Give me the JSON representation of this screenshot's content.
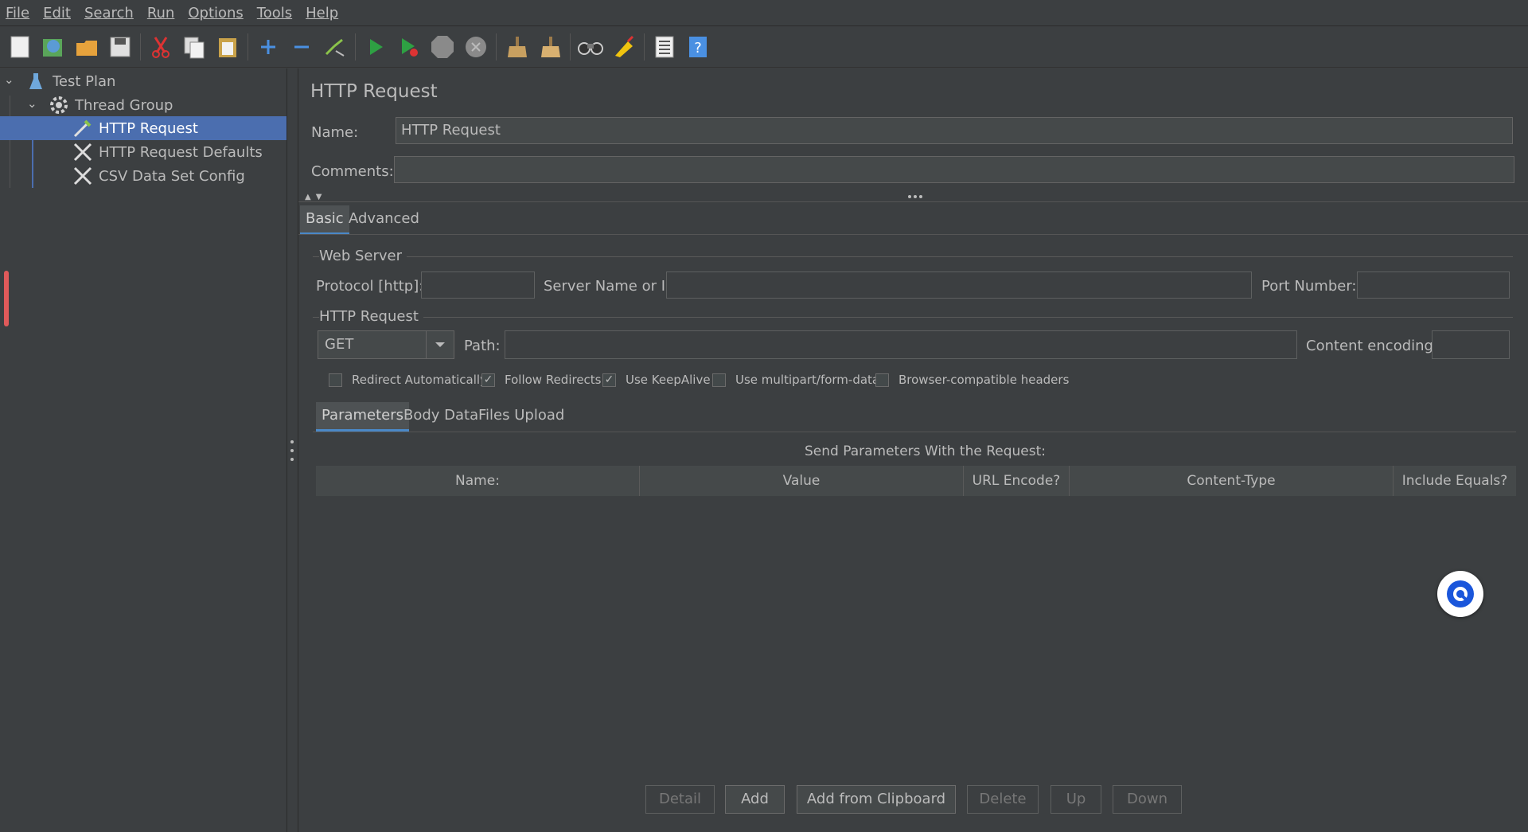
{
  "menu": {
    "items": [
      {
        "label": "File"
      },
      {
        "label": "Edit"
      },
      {
        "label": "Search"
      },
      {
        "label": "Run"
      },
      {
        "label": "Options"
      },
      {
        "label": "Tools"
      },
      {
        "label": "Help"
      }
    ]
  },
  "toolbar": {
    "icons": [
      "new-icon",
      "templates-icon",
      "open-icon",
      "save-icon",
      "cut-icon",
      "copy-icon",
      "paste-icon",
      "expand-icon",
      "collapse-icon",
      "toggle-icon",
      "start-icon",
      "start-no-pauses-icon",
      "stop-icon",
      "shutdown-icon",
      "clear-icon",
      "clear-all-icon",
      "search-icon",
      "reset-search-icon",
      "function-helper-icon",
      "help-icon"
    ]
  },
  "tree": {
    "items": [
      {
        "label": "Test Plan"
      },
      {
        "label": "Thread Group"
      },
      {
        "label": "HTTP Request"
      },
      {
        "label": "HTTP Request Defaults"
      },
      {
        "label": "CSV Data Set Config"
      }
    ]
  },
  "panel": {
    "title": "HTTP Request",
    "name_label": "Name:",
    "name_value": "HTTP Request",
    "comments_label": "Comments:",
    "comments_value": "",
    "tabs": [
      {
        "label": "Basic"
      },
      {
        "label": "Advanced"
      }
    ],
    "web_server": {
      "title": "Web Server",
      "protocol_label": "Protocol [http]:",
      "server_label": "Server Name or IP:",
      "port_label": "Port Number:"
    },
    "http_request": {
      "title": "HTTP Request",
      "method": "GET",
      "path_label": "Path:",
      "encoding_label": "Content encoding:"
    },
    "checkboxes": [
      {
        "label": "Redirect Automatically",
        "checked": false
      },
      {
        "label": "Follow Redirects",
        "checked": true
      },
      {
        "label": "Use KeepAlive",
        "checked": true
      },
      {
        "label": "Use multipart/form-data",
        "checked": false
      },
      {
        "label": "Browser-compatible headers",
        "checked": false
      }
    ],
    "subtabs": [
      {
        "label": "Parameters"
      },
      {
        "label": "Body Data"
      },
      {
        "label": "Files Upload"
      }
    ],
    "table": {
      "caption": "Send Parameters With the Request:",
      "columns": [
        "Name:",
        "Value",
        "URL Encode?",
        "Content-Type",
        "Include Equals?"
      ]
    },
    "buttons": [
      {
        "label": "Detail"
      },
      {
        "label": "Add"
      },
      {
        "label": "Add from Clipboard"
      },
      {
        "label": "Delete"
      },
      {
        "label": "Up"
      },
      {
        "label": "Down"
      }
    ]
  },
  "colors": {
    "background": "#3c3f41",
    "selection": "#4b6eaf",
    "text": "#bbbbbb"
  }
}
